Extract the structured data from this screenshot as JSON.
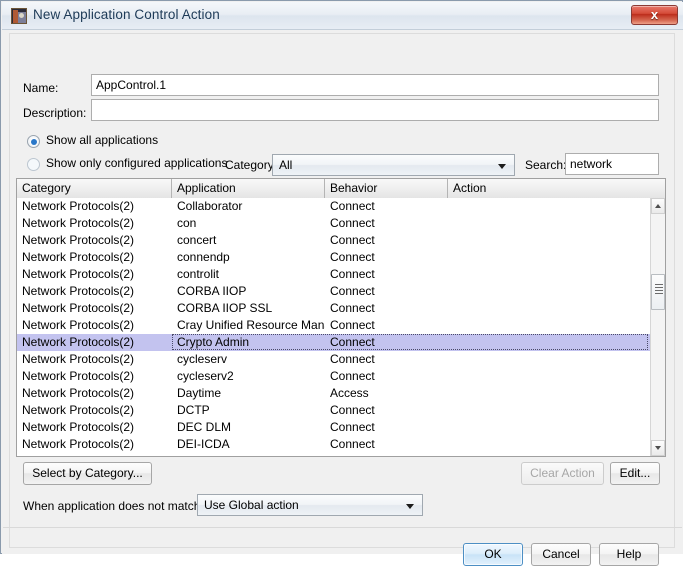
{
  "window": {
    "title": "New Application Control Action",
    "icon": "app-window-icon",
    "close_label": "x"
  },
  "form": {
    "name_label": "Name:",
    "name_value": "AppControl.1",
    "description_label": "Description:",
    "description_value": ""
  },
  "filters": {
    "radio_all_label": "Show all applications",
    "radio_configured_label": "Show only configured applications",
    "radio_selected": "all",
    "category_label": "Category:",
    "category_value": "All",
    "search_label": "Search:",
    "search_value": "network"
  },
  "table": {
    "columns": [
      "Category",
      "Application",
      "Behavior",
      "Action"
    ],
    "rows": [
      {
        "category": "Network Protocols(2)",
        "application": "Collaborator",
        "behavior": "Connect",
        "action": "",
        "selected": false
      },
      {
        "category": "Network Protocols(2)",
        "application": "con",
        "behavior": "Connect",
        "action": "",
        "selected": false
      },
      {
        "category": "Network Protocols(2)",
        "application": "concert",
        "behavior": "Connect",
        "action": "",
        "selected": false
      },
      {
        "category": "Network Protocols(2)",
        "application": "connendp",
        "behavior": "Connect",
        "action": "",
        "selected": false
      },
      {
        "category": "Network Protocols(2)",
        "application": "controlit",
        "behavior": "Connect",
        "action": "",
        "selected": false
      },
      {
        "category": "Network Protocols(2)",
        "application": "CORBA IIOP",
        "behavior": "Connect",
        "action": "",
        "selected": false
      },
      {
        "category": "Network Protocols(2)",
        "application": "CORBA IIOP SSL",
        "behavior": "Connect",
        "action": "",
        "selected": false
      },
      {
        "category": "Network Protocols(2)",
        "application": "Cray Unified Resource Mana...",
        "behavior": "Connect",
        "action": "",
        "selected": false
      },
      {
        "category": "Network Protocols(2)",
        "application": "Crypto Admin",
        "behavior": "Connect",
        "action": "",
        "selected": true
      },
      {
        "category": "Network Protocols(2)",
        "application": "cycleserv",
        "behavior": "Connect",
        "action": "",
        "selected": false
      },
      {
        "category": "Network Protocols(2)",
        "application": "cycleserv2",
        "behavior": "Connect",
        "action": "",
        "selected": false
      },
      {
        "category": "Network Protocols(2)",
        "application": "Daytime",
        "behavior": "Access",
        "action": "",
        "selected": false
      },
      {
        "category": "Network Protocols(2)",
        "application": "DCTP",
        "behavior": "Connect",
        "action": "",
        "selected": false
      },
      {
        "category": "Network Protocols(2)",
        "application": "DEC DLM",
        "behavior": "Connect",
        "action": "",
        "selected": false
      },
      {
        "category": "Network Protocols(2)",
        "application": "DEI-ICDA",
        "behavior": "Connect",
        "action": "",
        "selected": false
      }
    ]
  },
  "actions": {
    "select_by_category_label": "Select by Category...",
    "clear_action_label": "Clear Action",
    "clear_action_enabled": false,
    "edit_label": "Edit...",
    "no_match_label": "When application does not match:",
    "no_match_value": "Use Global action"
  },
  "footer": {
    "ok_label": "OK",
    "cancel_label": "Cancel",
    "help_label": "Help"
  },
  "colors": {
    "selection": "#c3c3ef",
    "close_button": "#d44b38",
    "default_button_border": "#4d8fc4",
    "radio_dot": "#2a77c8",
    "title_text": "#1d3a57"
  }
}
